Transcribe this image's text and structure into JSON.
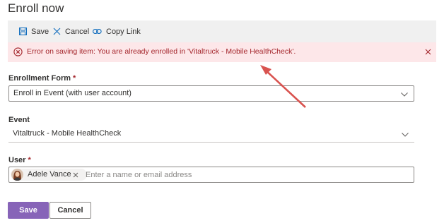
{
  "page": {
    "title": "Enroll now"
  },
  "toolbar": {
    "save_label": "Save",
    "cancel_label": "Cancel",
    "copy_link_label": "Copy Link"
  },
  "error": {
    "message": "Error on saving item: You are already enrolled in 'Vitaltruck - Mobile HealthCheck'.",
    "color": "#a4262c",
    "background": "#fde7e9"
  },
  "form": {
    "enrollment_form": {
      "label": "Enrollment Form",
      "required_mark": "*",
      "value": "Enroll in Event (with user account)"
    },
    "event": {
      "label": "Event",
      "value": "Vitaltruck - Mobile HealthCheck"
    },
    "user": {
      "label": "User",
      "required_mark": "*",
      "selected_person": "Adele Vance",
      "placeholder": "Enter a name or email address"
    }
  },
  "buttons": {
    "save_label": "Save",
    "cancel_label": "Cancel"
  },
  "colors": {
    "primary": "#8764b8",
    "annotation_arrow": "#d9534f"
  }
}
